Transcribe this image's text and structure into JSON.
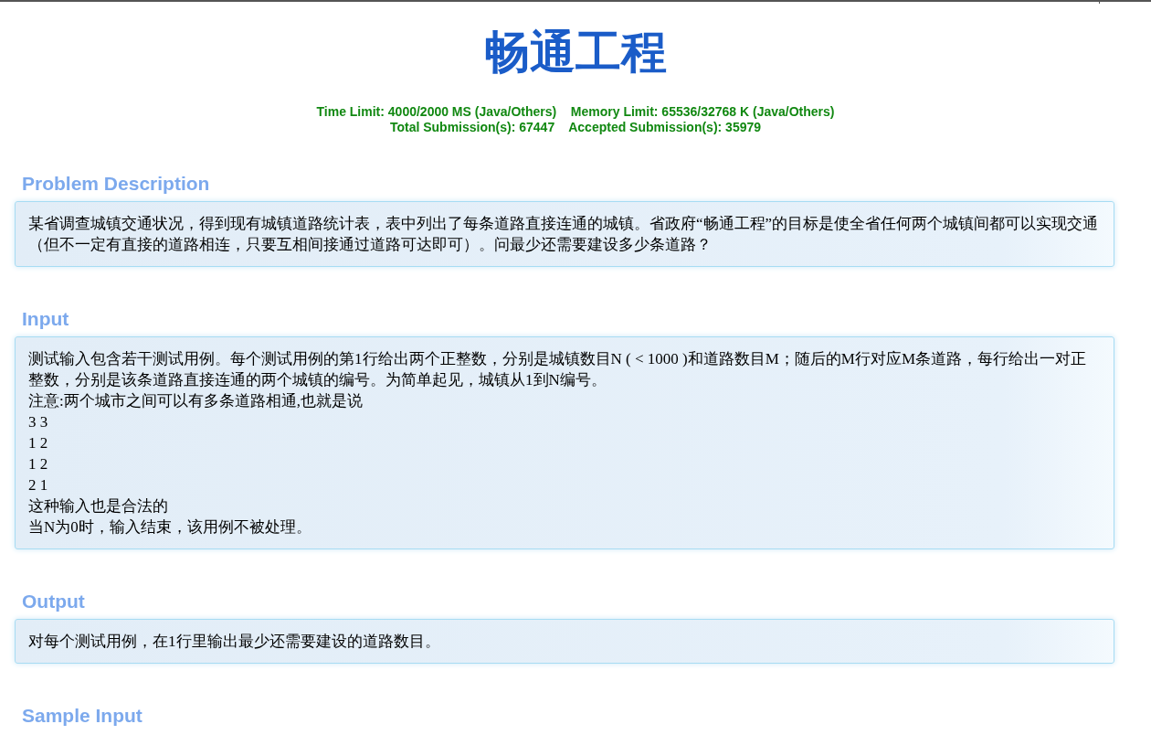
{
  "title": "畅通工程",
  "limits": [
    "Time Limit: 4000/2000 MS (Java/Others)    Memory Limit: 65536/32768 K (Java/Others)",
    "Total Submission(s): 67447    Accepted Submission(s): 35979"
  ],
  "sections": [
    {
      "heading": "Problem Description",
      "lines": [
        "某省调查城镇交通状况，得到现有城镇道路统计表，表中列出了每条道路直接连通的城镇。省政府“畅通工程”的目标是使全省任何两个城镇间都可以实现交通（但不一定有直接的道路相连，只要互相间接通过道路可达即可）。问最少还需要建设多少条道路？"
      ]
    },
    {
      "heading": "Input",
      "lines": [
        "测试输入包含若干测试用例。每个测试用例的第1行给出两个正整数，分别是城镇数目N ( < 1000 )和道路数目M；随后的M行对应M条道路，每行给出一对正整数，分别是该条道路直接连通的两个城镇的编号。为简单起见，城镇从1到N编号。",
        "注意:两个城市之间可以有多条道路相通,也就是说",
        "3 3",
        "1 2",
        "1 2",
        "2 1",
        "这种输入也是合法的",
        "当N为0时，输入结束，该用例不被处理。"
      ]
    },
    {
      "heading": "Output",
      "lines": [
        "对每个测试用例，在1行里输出最少还需要建设的道路数目。"
      ]
    },
    {
      "heading": "Sample Input"
    }
  ]
}
